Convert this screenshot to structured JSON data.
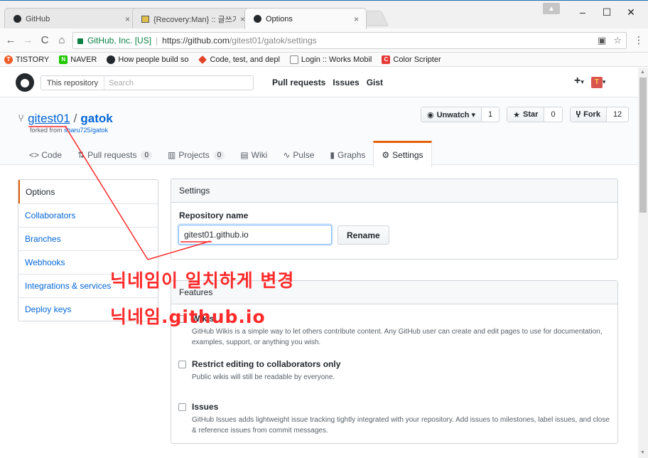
{
  "browser": {
    "tabs": [
      {
        "title": "GitHub",
        "icon": "github-icon"
      },
      {
        "title": "{Recovery:Man} :: 글쓰기",
        "icon": "page-icon"
      },
      {
        "title": "Options",
        "icon": "github-icon"
      }
    ],
    "tab_close": "×",
    "window": {
      "minimize": "–",
      "maximize": "☐",
      "close": "✕"
    },
    "address": {
      "security_label": "GitHub, Inc. [US]",
      "url_host": "https://github.com",
      "url_path": "/gitest01/gatok/settings"
    },
    "bookmarks": [
      {
        "label": "TISTORY",
        "color": "#f05a28",
        "glyph": "T"
      },
      {
        "label": "NAVER",
        "color": "#1ec800",
        "glyph": "N"
      },
      {
        "label": "How people build so",
        "color": "#24292e",
        "glyph": ""
      },
      {
        "label": "Code, test, and depl",
        "color": "#e24329",
        "glyph": ""
      },
      {
        "label": "Login :: Works Mobil",
        "color": "#ffffff",
        "glyph": ""
      },
      {
        "label": "Color Scripter",
        "color": "#e53935",
        "glyph": "C"
      }
    ]
  },
  "github": {
    "search_scope": "This repository",
    "search_placeholder": "Search",
    "nav": [
      "Pull requests",
      "Issues",
      "Gist"
    ],
    "owner": "gitest01",
    "repo": "gatok",
    "forked_from_prefix": "forked from ",
    "forked_from": "sharu725/gatok",
    "actions": {
      "watch_label": "Unwatch ▾",
      "watch_count": "1",
      "star_label": "Star",
      "star_count": "0",
      "fork_label": "Fork",
      "fork_count": "12"
    },
    "tabs": [
      {
        "label": "<> Code"
      },
      {
        "label": "Pull requests",
        "count": "0"
      },
      {
        "label": "Projects",
        "count": "0"
      },
      {
        "label": "Wiki"
      },
      {
        "label": "Pulse"
      },
      {
        "label": "Graphs"
      },
      {
        "label": "Settings"
      }
    ],
    "sidebar": [
      "Options",
      "Collaborators",
      "Branches",
      "Webhooks",
      "Integrations & services",
      "Deploy keys"
    ],
    "settings": {
      "heading": "Settings",
      "repo_name_label": "Repository name",
      "repo_name_value": "gitest01.github.io",
      "rename_button": "Rename"
    },
    "features": {
      "heading": "Features",
      "items": [
        {
          "title": "Wikis",
          "desc": "GitHub Wikis is a simple way to let others contribute content. Any GitHub user can create and edit pages to use for documentation, examples, support, or anything you wish."
        },
        {
          "title": "Restrict editing to collaborators only",
          "desc": "Public wikis will still be readable by everyone."
        },
        {
          "title": "Issues",
          "desc": "GitHub Issues adds lightweight issue tracking tightly integrated with your repository. Add issues to milestones, label issues, and close & reference issues from commit messages."
        }
      ]
    }
  },
  "annotations": {
    "line1": "닉네임이 일치하게 변경",
    "line2": "닉네임.github.io",
    "color": "#ff2a2a"
  }
}
